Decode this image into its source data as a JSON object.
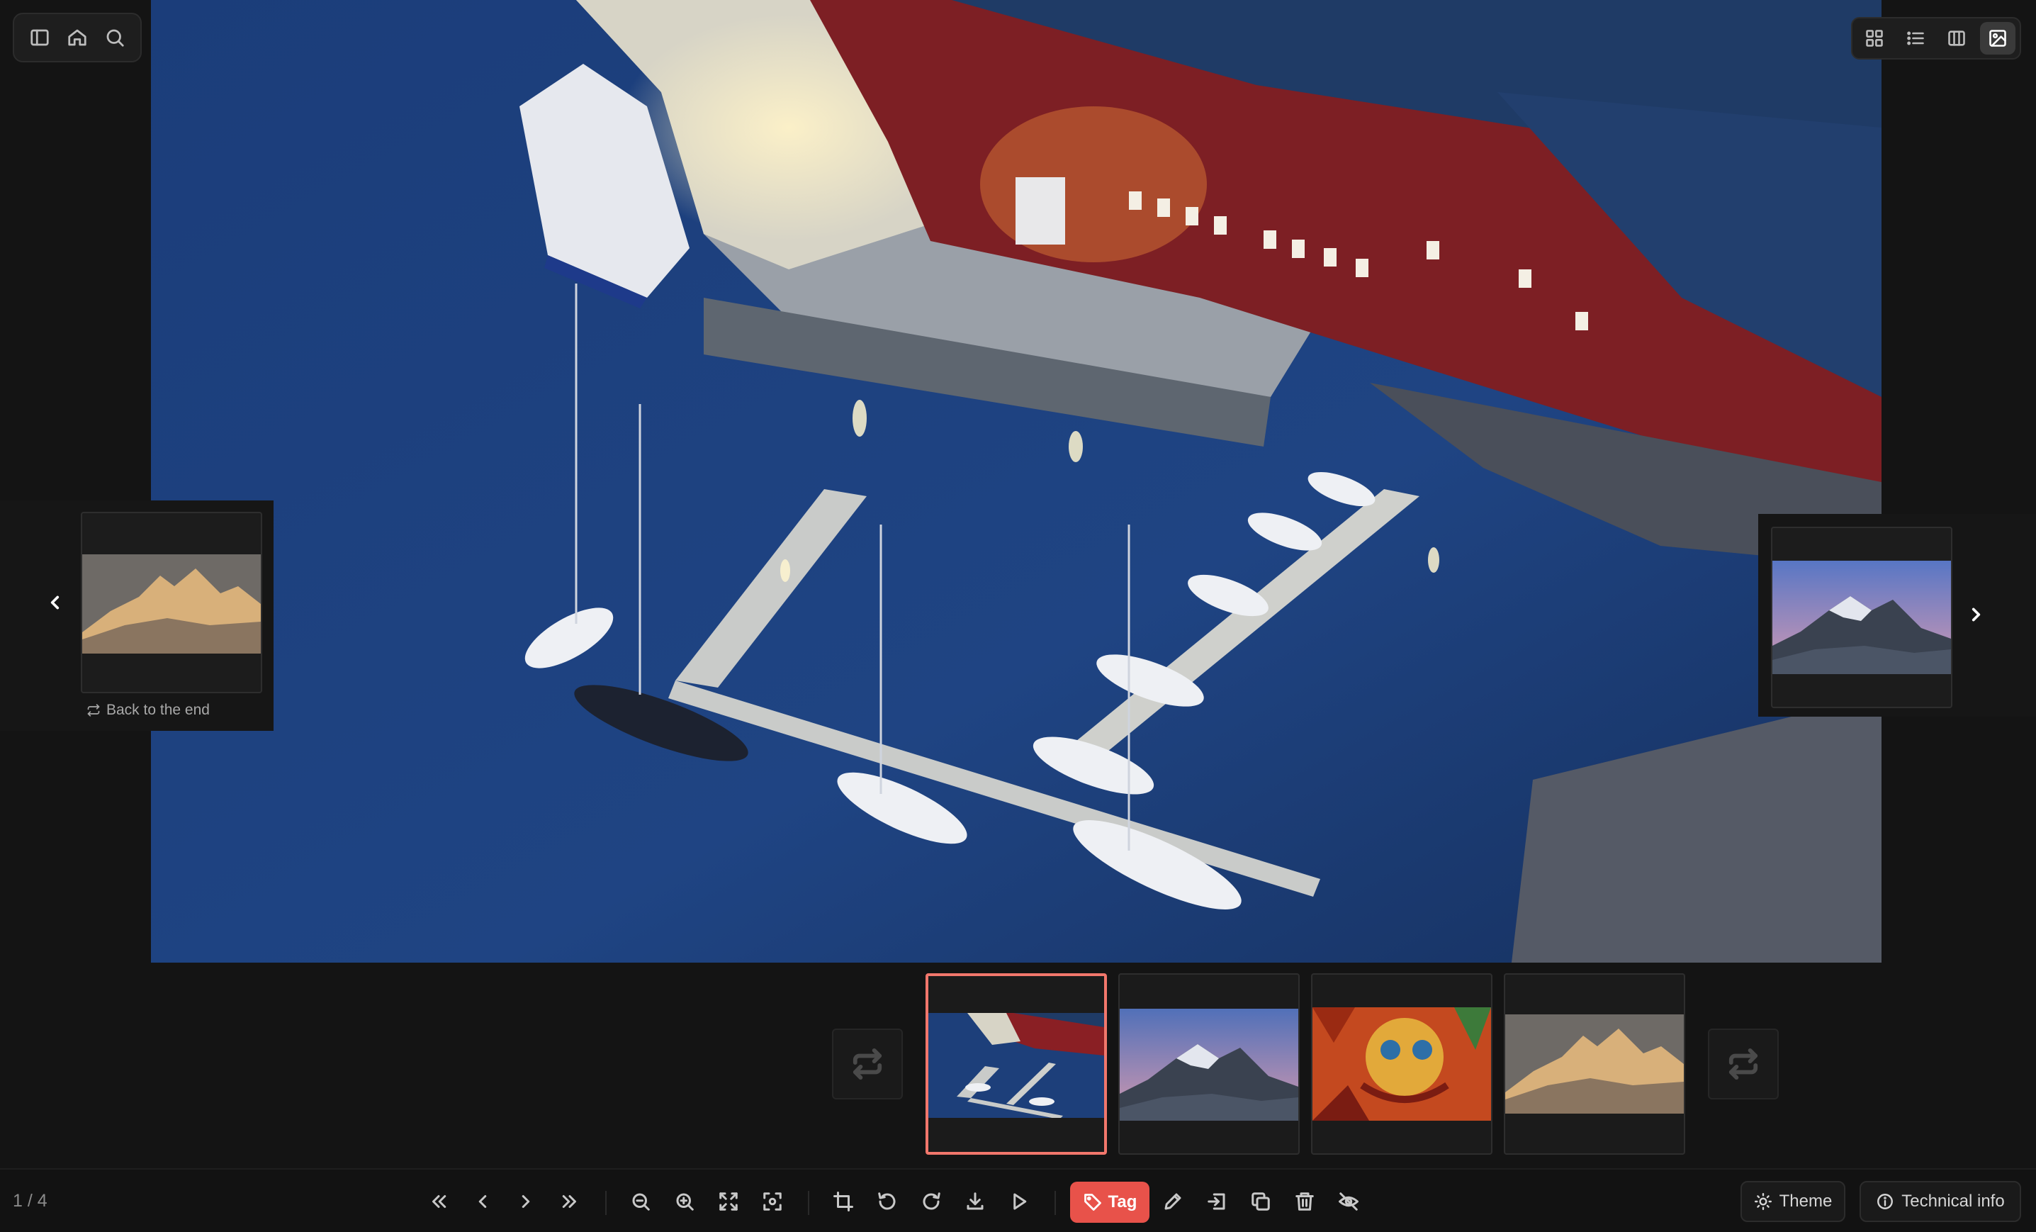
{
  "main_photo": {
    "alt": "Harbor with boats at dusk"
  },
  "top_left_toolbar": {
    "icons": [
      "sidebar-toggle-icon",
      "home-icon",
      "search-icon"
    ]
  },
  "view_switcher": {
    "icons": [
      "grid-view-icon",
      "list-view-icon",
      "columns-view-icon",
      "image-view-icon"
    ],
    "active": "image-view-icon"
  },
  "previous_preview": {
    "caption": "Back to the end",
    "thumbnail": "golden-mountain-peaks"
  },
  "next_preview": {
    "thumbnail": "pink-sky-mountain"
  },
  "filmstrip": {
    "items": [
      {
        "thumbnail": "harbor-boats-dusk",
        "selected": true
      },
      {
        "thumbnail": "pink-sky-mountain",
        "selected": false
      },
      {
        "thumbnail": "dragon-mural",
        "selected": false
      },
      {
        "thumbnail": "golden-mountain-peaks",
        "selected": false
      }
    ]
  },
  "toolbar": {
    "counter": "1 / 4",
    "tag_label": "Tag",
    "theme_label": "Theme",
    "technical_info_label": "Technical info",
    "accent_color": "#e8524a",
    "selection_color": "#f2776c"
  }
}
